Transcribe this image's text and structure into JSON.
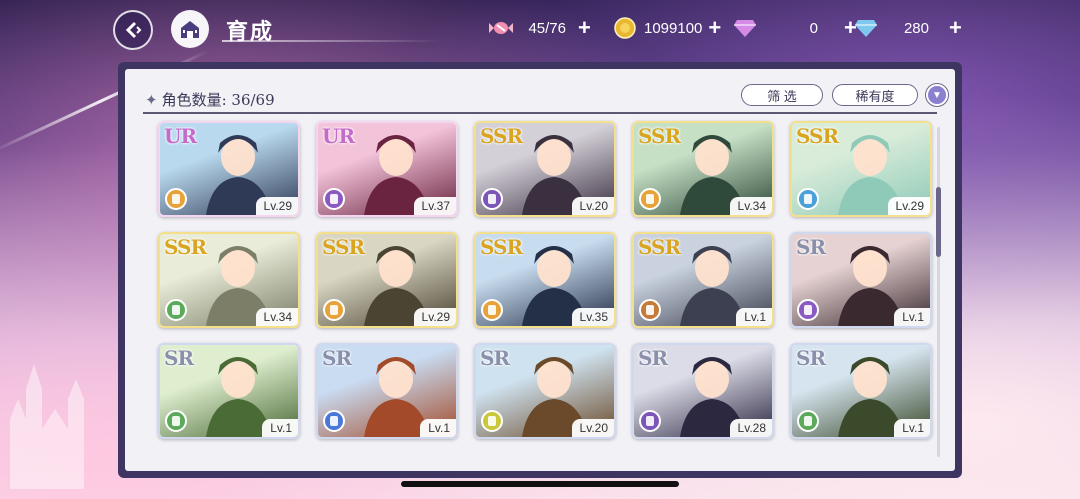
{
  "header": {
    "title": "育成"
  },
  "currencies": [
    {
      "icon": "candy-icon",
      "value": "45/76",
      "color": "#f08fb0"
    },
    {
      "icon": "gold-coin-icon",
      "value": "1099100",
      "color": "#e8b832"
    },
    {
      "icon": "pink-diamond-icon",
      "value": "0",
      "color": "#d58ae8"
    },
    {
      "icon": "blue-diamond-icon",
      "value": "280",
      "color": "#7ec8f0"
    }
  ],
  "panel": {
    "count_label": "角色数量: 36/69",
    "filter_label": "筛 选",
    "rarity_label": "稀有度"
  },
  "characters": [
    {
      "rarity": "UR",
      "level": "Lv.29",
      "element_color": "#e7a33a",
      "bg": [
        "#b9d9ee",
        "#2f3a56"
      ]
    },
    {
      "rarity": "UR",
      "level": "Lv.37",
      "element_color": "#8a5ac0",
      "bg": [
        "#f2c3d9",
        "#6a2440"
      ]
    },
    {
      "rarity": "SSR",
      "level": "Lv.20",
      "element_color": "#7b56b8",
      "bg": [
        "#d4d0d8",
        "#3a3040"
      ]
    },
    {
      "rarity": "SSR",
      "level": "Lv.34",
      "element_color": "#e7a33a",
      "bg": [
        "#c6e0c6",
        "#2f4a3a"
      ]
    },
    {
      "rarity": "SSR",
      "level": "Lv.29",
      "element_color": "#4aa0d8",
      "bg": [
        "#d8ecd9",
        "#8fc9b8"
      ]
    },
    {
      "rarity": "SSR",
      "level": "Lv.34",
      "element_color": "#5aaa5a",
      "bg": [
        "#e8ecd8",
        "#7c7e68"
      ]
    },
    {
      "rarity": "SSR",
      "level": "Lv.29",
      "element_color": "#e7a33a",
      "bg": [
        "#d9d6c4",
        "#4c4432"
      ]
    },
    {
      "rarity": "SSR",
      "level": "Lv.35",
      "element_color": "#e7a33a",
      "bg": [
        "#c8dcef",
        "#243048"
      ]
    },
    {
      "rarity": "SSR",
      "level": "Lv.1",
      "element_color": "#c57a3a",
      "bg": [
        "#c9d2de",
        "#3c4050"
      ]
    },
    {
      "rarity": "SR",
      "level": "Lv.1",
      "element_color": "#8a5ac0",
      "bg": [
        "#e6d2d2",
        "#3a2a30"
      ]
    },
    {
      "rarity": "SR",
      "level": "Lv.1",
      "element_color": "#5aaa5a",
      "bg": [
        "#dfeecf",
        "#4a6a36"
      ]
    },
    {
      "rarity": "SR",
      "level": "Lv.1",
      "element_color": "#4a78d8",
      "bg": [
        "#c9dcf2",
        "#a24a2a"
      ]
    },
    {
      "rarity": "SR",
      "level": "Lv.20",
      "element_color": "#c8c83a",
      "bg": [
        "#cfe2ef",
        "#6a4a2a"
      ]
    },
    {
      "rarity": "SR",
      "level": "Lv.28",
      "element_color": "#7b56b8",
      "bg": [
        "#dcdce8",
        "#2c2840"
      ]
    },
    {
      "rarity": "SR",
      "level": "Lv.1",
      "element_color": "#5aaa5a",
      "bg": [
        "#d6e4ef",
        "#3a4a2a"
      ]
    }
  ]
}
